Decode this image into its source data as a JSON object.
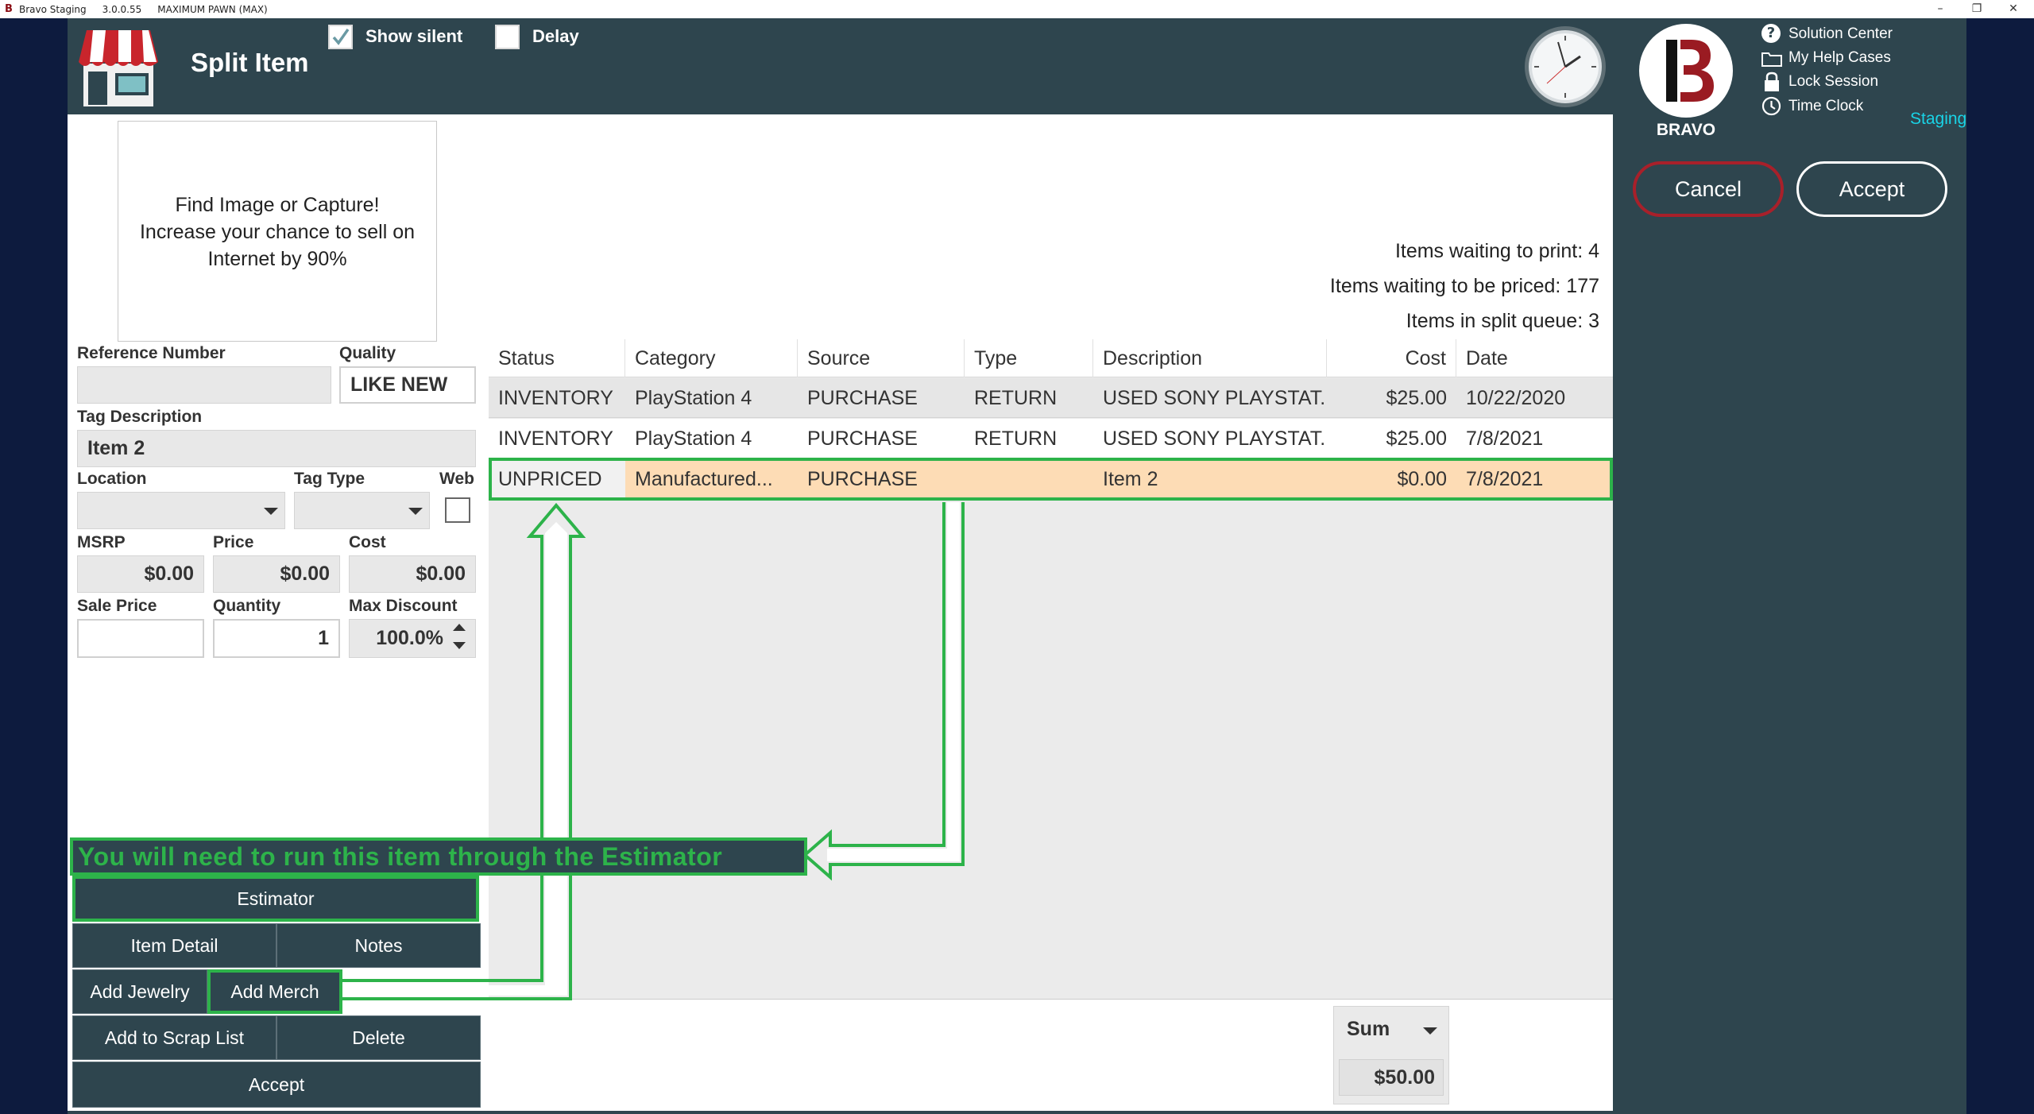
{
  "titlebar": {
    "app": "Bravo Staging",
    "version": "3.0.0.55",
    "store": "MAXIMUM PAWN (MAX)"
  },
  "header": {
    "title": "Split Item",
    "show_silent_label": "Show silent",
    "show_silent_checked": true,
    "delay_label": "Delay",
    "delay_checked": false
  },
  "right_panel": {
    "brand": "BRAVO",
    "links": [
      "Solution Center",
      "My Help Cases",
      "Lock Session",
      "Time Clock"
    ],
    "environment": "Staging",
    "cancel_label": "Cancel",
    "accept_label": "Accept"
  },
  "image_placeholder": {
    "line1": "Find Image or Capture!",
    "line2": "Increase your chance to sell on",
    "line3": "Internet by 90%"
  },
  "form": {
    "reference_number_label": "Reference Number",
    "reference_number_value": "",
    "quality_label": "Quality",
    "quality_value": "LIKE NEW",
    "tag_description_label": "Tag Description",
    "tag_description_value": "Item 2",
    "location_label": "Location",
    "tag_type_label": "Tag Type",
    "web_label": "Web",
    "msrp_label": "MSRP",
    "msrp_value": "$0.00",
    "price_label": "Price",
    "price_value": "$0.00",
    "cost_label": "Cost",
    "cost_value": "$0.00",
    "sale_price_label": "Sale Price",
    "sale_price_value": "",
    "quantity_label": "Quantity",
    "quantity_value": "1",
    "max_discount_label": "Max Discount",
    "max_discount_value": "100.0%"
  },
  "stats": {
    "print": "Items waiting to print: 4",
    "priced": "Items waiting to be priced: 177",
    "split": "Items in split queue: 3"
  },
  "grid": {
    "columns": [
      "Status",
      "Category",
      "Source",
      "Type",
      "Description",
      "Cost",
      "Date"
    ],
    "rows": [
      [
        "INVENTORY",
        "PlayStation 4",
        "PURCHASE",
        "RETURN",
        "USED SONY PLAYSTAT...",
        "$25.00",
        "10/22/2020"
      ],
      [
        "INVENTORY",
        "PlayStation 4",
        "PURCHASE",
        "RETURN",
        "USED SONY PLAYSTAT...",
        "$25.00",
        "7/8/2021"
      ],
      [
        "UNPRICED",
        "Manufactured...",
        "PURCHASE",
        "",
        "Item 2",
        "$0.00",
        "7/8/2021"
      ]
    ]
  },
  "footer": {
    "aggregate": "Sum",
    "total": "$50.00"
  },
  "buttons": {
    "estimator": "Estimator",
    "item_detail": "Item Detail",
    "notes": "Notes",
    "add_jewelry": "Add Jewelry",
    "add_merch": "Add Merch",
    "add_scrap": "Add to Scrap List",
    "delete": "Delete",
    "accept": "Accept"
  },
  "annotation": {
    "text": "You will need to run this item through the Estimator"
  },
  "colors": {
    "frame": "#2e454e",
    "highlight_row": "#fddcb5",
    "annotation": "#2db34a",
    "cancel_border": "#a8202a",
    "staging": "#19d3e6"
  }
}
